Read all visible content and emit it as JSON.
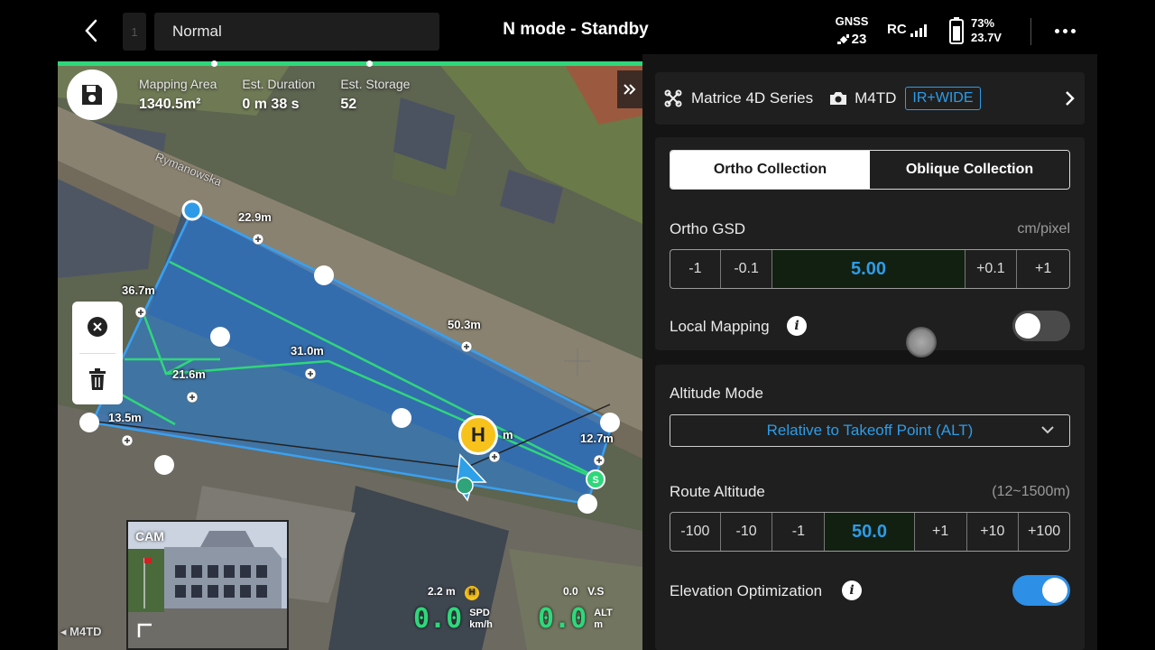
{
  "topbar": {
    "route_index": "1",
    "mode_label": "Normal",
    "status": "N mode - Standby",
    "gnss_label": "GNSS",
    "gnss_sats": "23",
    "rc_label": "RC",
    "battery_percent": "73%",
    "battery_voltage": "23.7V"
  },
  "map": {
    "info": {
      "area_label": "Mapping Area",
      "area_value": "1340.5m²",
      "duration_label": "Est. Duration",
      "duration_value": "0 m 38 s",
      "storage_label": "Est. Storage",
      "storage_value": "52"
    },
    "road_name": "Rymanowska",
    "edge_labels": [
      "22.9m",
      "36.7m",
      "50.3m",
      "31.0m",
      "21.6m",
      "13.5m",
      "12.7m",
      "m"
    ],
    "home_letter": "H",
    "start_letter": "S",
    "camera_label": "CAM",
    "payload_label": "M4TD",
    "telemetry": {
      "dist": "2.2 m",
      "home_icon": "H",
      "speed": "0.0",
      "speed_label": "SPD",
      "speed_unit": "km/h",
      "vs": "0.0",
      "vs_label": "V.S",
      "alt": "0.0",
      "alt_label": "ALT",
      "alt_unit": "m"
    }
  },
  "panel": {
    "aircraft": "Matrice 4D Series",
    "camera": "M4TD",
    "camera_mode": "IR+WIDE",
    "tabs": [
      {
        "label": "Ortho Collection",
        "active": true
      },
      {
        "label": "Oblique Collection",
        "active": false
      }
    ],
    "gsd": {
      "label": "Ortho GSD",
      "unit": "cm/pixel",
      "steps_minus": [
        "-1",
        "-0.1"
      ],
      "value": "5.00",
      "steps_plus": [
        "+0.1",
        "+1"
      ]
    },
    "local_mapping": {
      "label": "Local Mapping",
      "enabled": false
    },
    "altitude_mode": {
      "label": "Altitude Mode",
      "value": "Relative to Takeoff Point (ALT)"
    },
    "route_altitude": {
      "label": "Route Altitude",
      "range": "(12~1500m)",
      "steps_minus": [
        "-100",
        "-10",
        "-1"
      ],
      "value": "50.0",
      "steps_plus": [
        "+1",
        "+10",
        "+100"
      ]
    },
    "elevation_optimization": {
      "label": "Elevation Optimization",
      "enabled": true
    }
  },
  "colors": {
    "accent_blue": "#2d9ce8",
    "route_green": "#2fd77b",
    "home_yellow": "#f8c21c"
  }
}
